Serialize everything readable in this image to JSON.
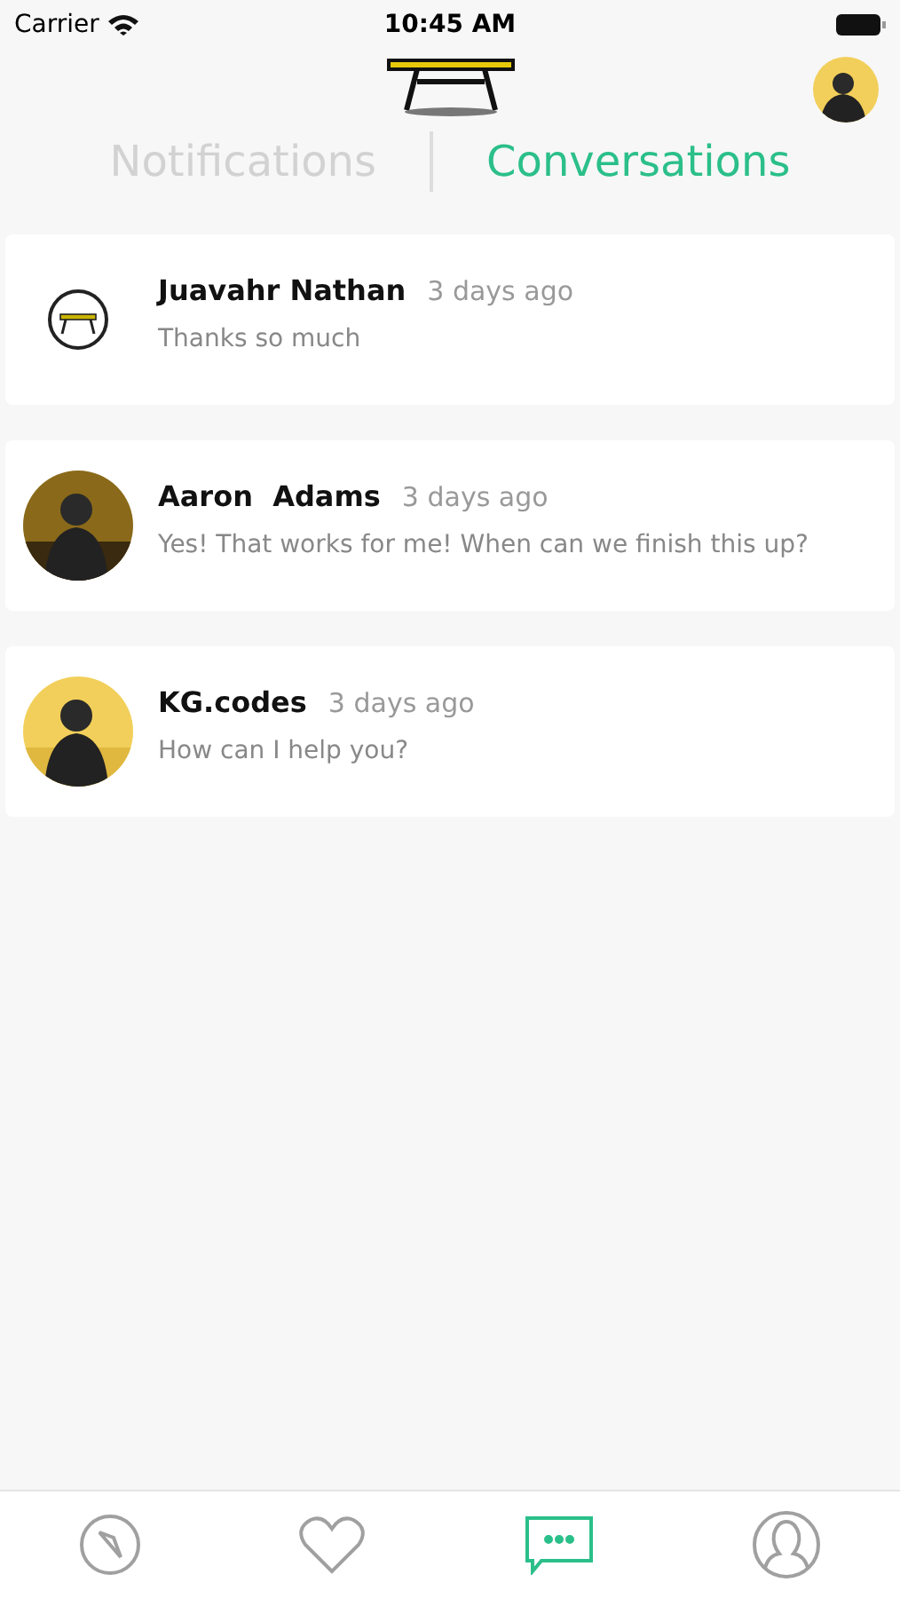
{
  "status_bar": {
    "carrier": "Carrier",
    "time": "10:45 AM"
  },
  "tabs": [
    {
      "label": "Notifications",
      "selected": false
    },
    {
      "label": "Conversations",
      "selected": true
    }
  ],
  "conversations": [
    {
      "name": "Juavahr Nathan",
      "time": "3 days ago",
      "message": "Thanks so much",
      "kind": "logo"
    },
    {
      "name": "Aaron  Adams",
      "time": "3 days ago",
      "message": "Yes! That works for me! When can we finish this up?"
    },
    {
      "name": "KG.codes",
      "time": "3 days ago",
      "message": "How can I help you?"
    }
  ],
  "tab_bar": [
    {
      "kind": "explore",
      "selected": false
    },
    {
      "kind": "favorites",
      "selected": false
    },
    {
      "kind": "messages",
      "selected": true
    },
    {
      "kind": "profile",
      "selected": false
    }
  ]
}
